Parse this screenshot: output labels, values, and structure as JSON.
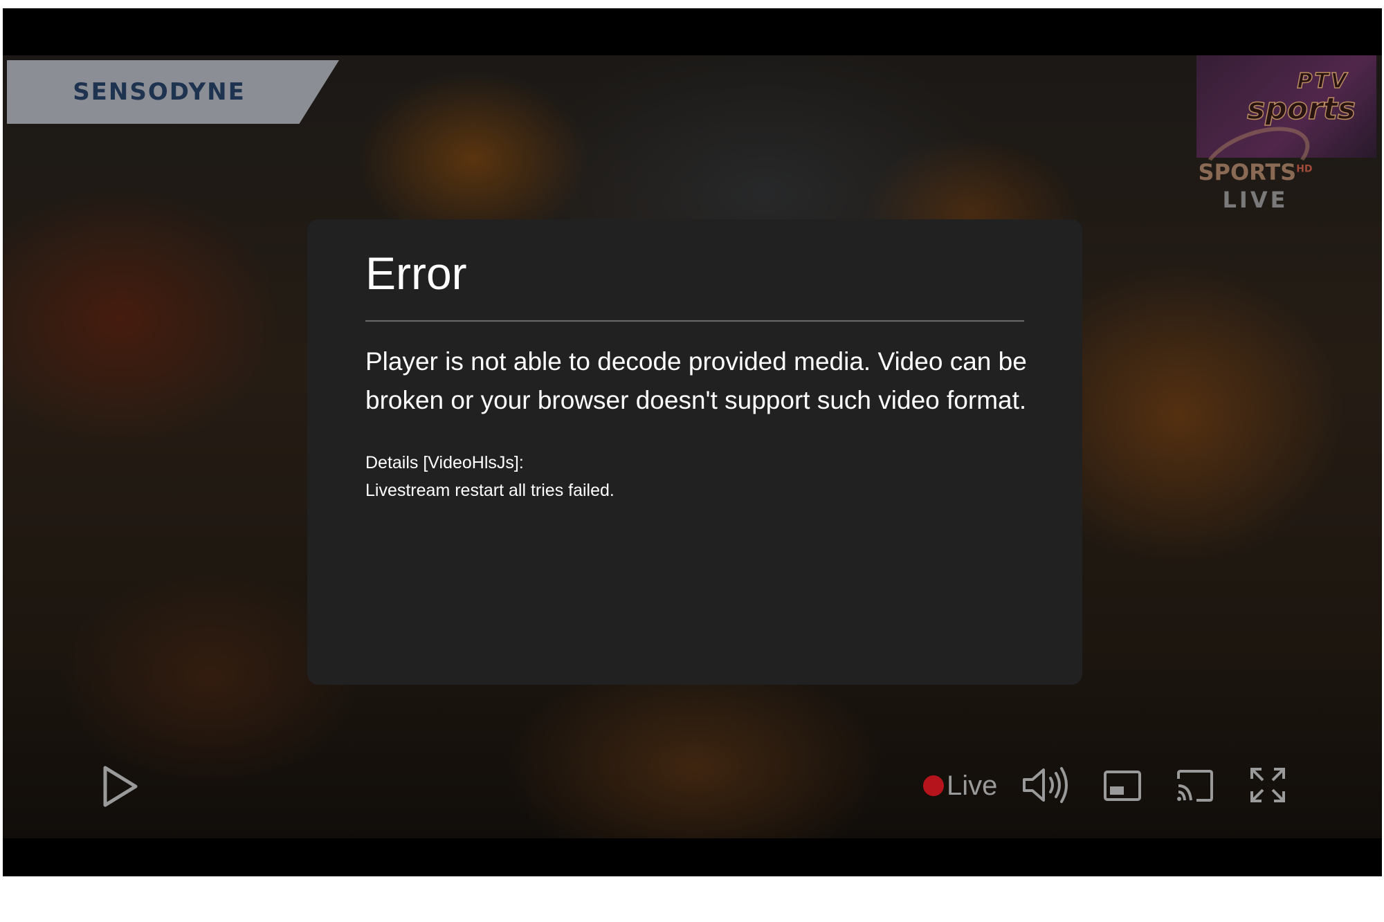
{
  "sponsor": {
    "text": "SENSODYNE"
  },
  "channel_logo": {
    "brand": "PTV",
    "name": "sports",
    "sub": "SPORTS",
    "hd": "HD",
    "live": "LIVE"
  },
  "error": {
    "title": "Error",
    "message": "Player is not able to decode provided media. Video can be broken or your browser doesn't support such video format.",
    "details_label": "Details [VideoHlsJs]:",
    "details_text": "Livestream restart all tries failed."
  },
  "controls": {
    "live_label": "Live",
    "icons": {
      "play": "play-icon",
      "volume": "volume-icon",
      "pip": "picture-in-picture-icon",
      "cast": "cast-icon",
      "fullscreen": "fullscreen-icon"
    },
    "live_color": "#b5141c",
    "icon_color": "#9a9a9a"
  }
}
